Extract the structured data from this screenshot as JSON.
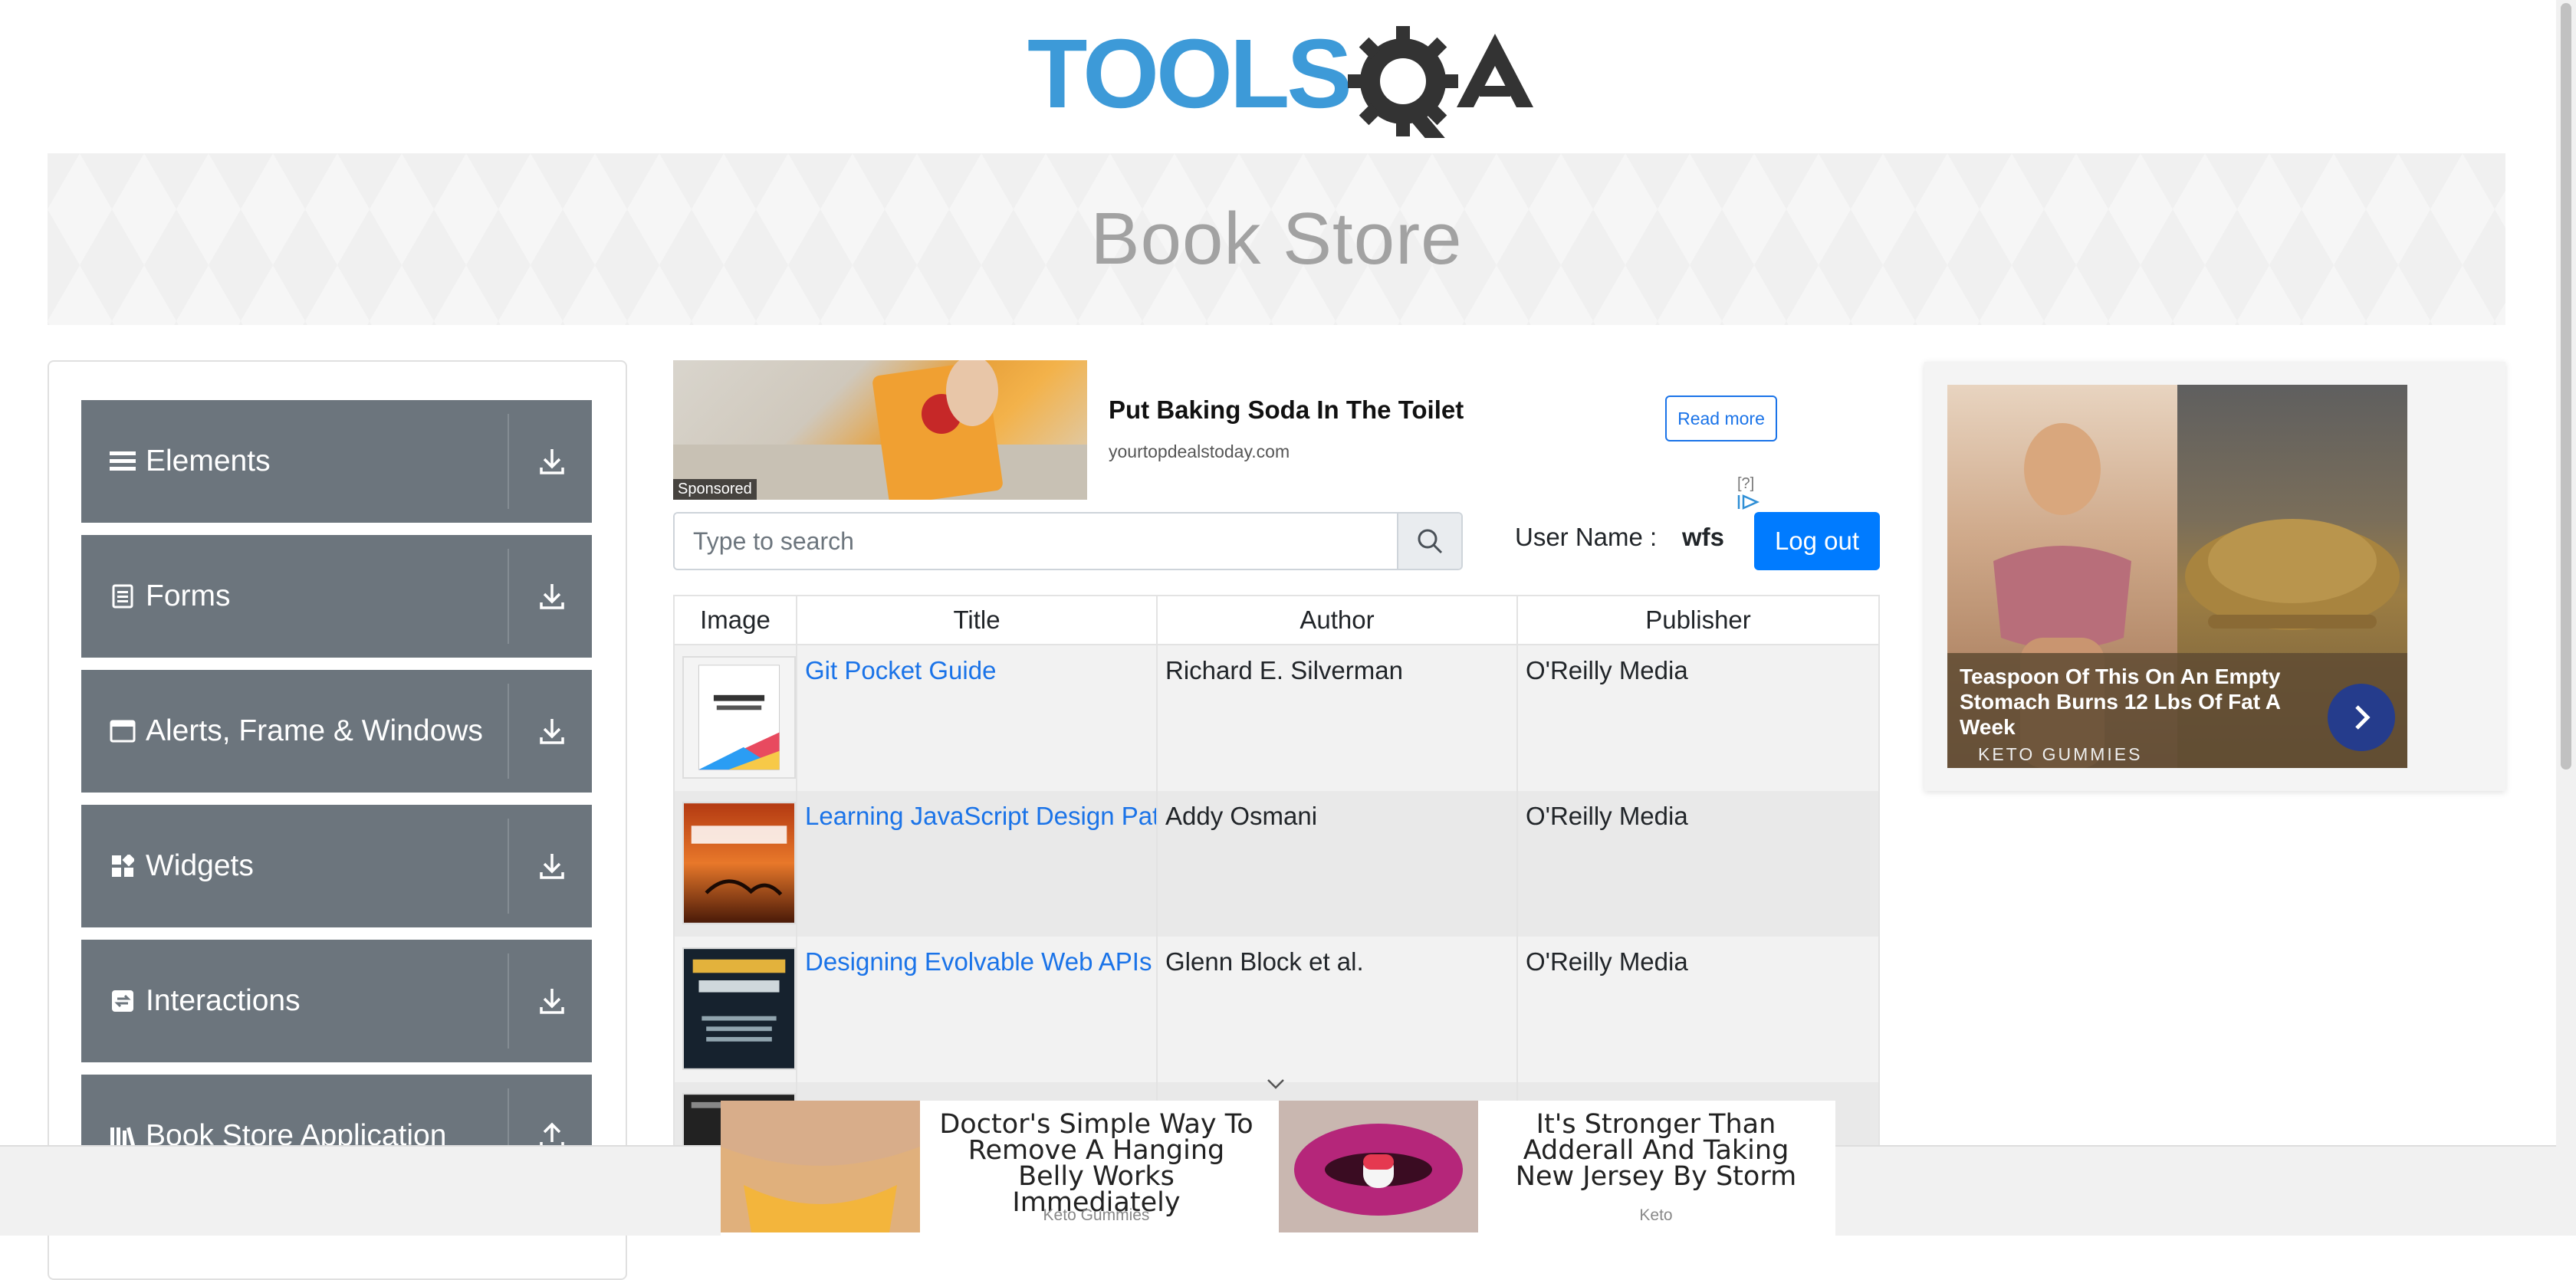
{
  "header": {
    "logo_text": "TOOLSQA"
  },
  "banner": {
    "title": "Book Store"
  },
  "sidebar": {
    "groups": [
      {
        "label": "Elements",
        "icon": "list-icon"
      },
      {
        "label": "Forms",
        "icon": "form-icon"
      },
      {
        "label": "Alerts, Frame & Windows",
        "icon": "window-icon"
      },
      {
        "label": "Widgets",
        "icon": "widgets-icon"
      },
      {
        "label": "Interactions",
        "icon": "interactions-icon"
      },
      {
        "label": "Book Store Application",
        "icon": "bookstore-icon"
      }
    ]
  },
  "ad_top": {
    "sponsored": "Sponsored",
    "headline": "Put Baking Soda In The Toilet",
    "url": "yourtopdealstoday.com",
    "read_more": "Read more",
    "choices": "[?]"
  },
  "search": {
    "placeholder": "Type to search"
  },
  "user": {
    "label": "User Name :",
    "value": "wfs",
    "logout": "Log out"
  },
  "table": {
    "headers": [
      "Image",
      "Title",
      "Author",
      "Publisher"
    ],
    "rows": [
      {
        "title": "Git Pocket Guide",
        "author": "Richard E. Silverman",
        "publisher": "O'Reilly Media"
      },
      {
        "title": "Learning JavaScript Design Patt",
        "author": "Addy Osmani",
        "publisher": "O'Reilly Media"
      },
      {
        "title": "Designing Evolvable Web APIs w",
        "author": "Glenn Block et al.",
        "publisher": "O'Reilly Media"
      }
    ]
  },
  "ad_right": {
    "headline": "Teaspoon Of This On An Empty Stomach Burns 12 Lbs Of Fat A Week",
    "brand": "KETO GUMMIES"
  },
  "ad_bottom": {
    "items": [
      {
        "title": "Doctor's Simple Way To Remove A Hanging Belly Works Immediately",
        "brand": "Keto Gummies"
      },
      {
        "title": "It's Stronger Than Adderall And Taking New Jersey By Storm",
        "brand": "Keto"
      }
    ]
  },
  "colors": {
    "sidebar_group": "#6c757d",
    "primary_button": "#007bff",
    "link": "#1a73e8",
    "logo_blue": "#3d9ad8",
    "logo_dark": "#333333"
  }
}
